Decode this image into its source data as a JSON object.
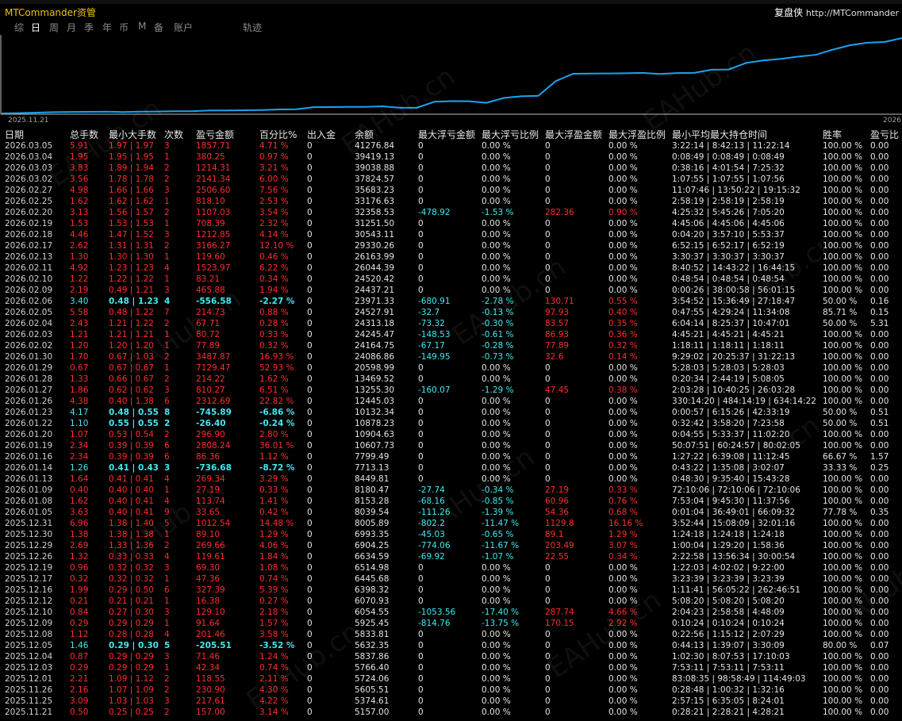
{
  "app": {
    "title": "MTCommander资管",
    "brand": "复盘侠",
    "url": "http://MTCommander"
  },
  "tabs": [
    "综",
    "日",
    "周",
    "月",
    "季",
    "年",
    "币",
    "M",
    "备",
    "账户",
    "轨迹"
  ],
  "active_tab": 1,
  "chart": {
    "start_label": "2025.11.21",
    "end_label": "2026.0",
    "line_color": "#1aa3f0"
  },
  "columns": [
    "日期",
    "总手数",
    "最小大手数",
    "次数",
    "盈亏金额",
    "百分比%",
    "出入金",
    "余额",
    "最大浮亏金额",
    "最大浮亏比例",
    "最大浮盈金额",
    "最大浮盈比例",
    "最小平均最大持仓时间",
    "胜率",
    "盈亏比"
  ],
  "watermark": "EAHub.cn",
  "rows": [
    [
      "2026.03.05",
      "5.91",
      "1.97 | 1.97",
      "3",
      "1857.71",
      "4.71 %",
      "0",
      "41276.84",
      "0",
      "0.00 %",
      "0",
      "0.00 %",
      "3:22:14 | 8:42:13 | 11:22:14",
      "100.00 %",
      "0.00"
    ],
    [
      "2026.03.04",
      "1.95",
      "1.95 | 1.95",
      "1",
      "380.25",
      "0.97 %",
      "0",
      "39419.13",
      "0",
      "0.00 %",
      "0",
      "0.00 %",
      "0:08:49 | 0:08:49 | 0:08:49",
      "100.00 %",
      "0.00"
    ],
    [
      "2026.03.03",
      "3.83",
      "1.89 | 1.94",
      "2",
      "1214.31",
      "3.21 %",
      "0",
      "39038.88",
      "0",
      "0.00 %",
      "0",
      "0.00 %",
      "0:38:16 | 4:01:54 | 7:25:32",
      "100.00 %",
      "0.00"
    ],
    [
      "2026.03.02",
      "3.56",
      "1.78 | 1.78",
      "2",
      "2141.34",
      "6.00 %",
      "0",
      "37824.57",
      "0",
      "0.00 %",
      "0",
      "0.00 %",
      "1:07:55 | 1:07:55 | 1:07:56",
      "100.00 %",
      "0.00"
    ],
    [
      "2026.02.27",
      "4.98",
      "1.66 | 1.66",
      "3",
      "2506.60",
      "7.56 %",
      "0",
      "35683.23",
      "0",
      "0.00 %",
      "0",
      "0.00 %",
      "11:07:46 | 13:50:22 | 19:15:32",
      "100.00 %",
      "0.00"
    ],
    [
      "2026.02.25",
      "1.62",
      "1.62 | 1.62",
      "1",
      "818.10",
      "2.53 %",
      "0",
      "33176.63",
      "0",
      "0.00 %",
      "0",
      "0.00 %",
      "2:58:19 | 2:58:19 | 2:58:19",
      "100.00 %",
      "0.00"
    ],
    [
      "2026.02.20",
      "3.13",
      "1.56 | 1.57",
      "2",
      "1107.03",
      "3.54 %",
      "0",
      "32358.53",
      "-478.92",
      "-1.53 %",
      "282.36",
      "0.90 %",
      "4:25:32 | 5:45:26 | 7:05:20",
      "100.00 %",
      "0.00"
    ],
    [
      "2026.02.19",
      "1.53",
      "1.53 | 1.53",
      "1",
      "708.39",
      "2.32 %",
      "0",
      "31251.50",
      "0",
      "0.00 %",
      "0",
      "0.00 %",
      "4:45:06 | 4:45:06 | 4:45:06",
      "100.00 %",
      "0.00"
    ],
    [
      "2026.02.18",
      "4.46",
      "1.47 | 1.52",
      "3",
      "1212.85",
      "4.14 %",
      "0",
      "30543.11",
      "0",
      "0.00 %",
      "0",
      "0.00 %",
      "0:04:20 | 3:57:10 | 5:53:37",
      "100.00 %",
      "0.00"
    ],
    [
      "2026.02.17",
      "2.62",
      "1.31 | 1.31",
      "2",
      "3166.27",
      "12.10 %",
      "0",
      "29330.26",
      "0",
      "0.00 %",
      "0",
      "0.00 %",
      "6:52:15 | 6:52:17 | 6:52:19",
      "100.00 %",
      "0.00"
    ],
    [
      "2026.02.13",
      "1.30",
      "1.30 | 1.30",
      "1",
      "119.60",
      "0.46 %",
      "0",
      "26163.99",
      "0",
      "0.00 %",
      "0",
      "0.00 %",
      "3:30:37 | 3:30:37 | 3:30:37",
      "100.00 %",
      "0.00"
    ],
    [
      "2026.02.11",
      "4.92",
      "1.23 | 1.23",
      "4",
      "1523.97",
      "6.22 %",
      "0",
      "26044.39",
      "0",
      "0.00 %",
      "0",
      "0.00 %",
      "8:40:52 | 14:43:22 | 16:44:15",
      "100.00 %",
      "0.00"
    ],
    [
      "2026.02.10",
      "1.22",
      "1.22 | 1.22",
      "1",
      "83.21",
      "0.34 %",
      "0",
      "24520.42",
      "0",
      "0.00 %",
      "0",
      "0.00 %",
      "0:48:54 | 0:48:54 | 0:48:54",
      "100.00 %",
      "0.00"
    ],
    [
      "2026.02.09",
      "2.19",
      "0.49 | 1.21",
      "3",
      "465.88",
      "1.94 %",
      "0",
      "24437.21",
      "0",
      "0.00 %",
      "0",
      "0.00 %",
      "0:00:26 | 38:00:58 | 56:01:15",
      "100.00 %",
      "0.00"
    ],
    [
      "2026.02.06",
      "3.40",
      "0.48 | 1.23",
      "4",
      "-556.58",
      "-2.27 %",
      "0",
      "23971.33",
      "-680.91",
      "-2.78 %",
      "130.71",
      "0.55 %",
      "3:54:52 | 15:36:49 | 27:18:47",
      "50.00 %",
      "0.16"
    ],
    [
      "2026.02.05",
      "5.58",
      "0.48 | 1.22",
      "7",
      "214.73",
      "0.88 %",
      "0",
      "24527.91",
      "-32.7",
      "-0.13 %",
      "97.93",
      "0.40 %",
      "0:47:55 | 4:29:24 | 11:34:08",
      "85.71 %",
      "0.15"
    ],
    [
      "2026.02.04",
      "2.43",
      "1.21 | 1.22",
      "2",
      "67.71",
      "0.28 %",
      "0",
      "24313.18",
      "-73.32",
      "-0.30 %",
      "83.57",
      "0.35 %",
      "6:04:14 | 8:25:37 | 10:47:01",
      "50.00 %",
      "5.31"
    ],
    [
      "2026.02.03",
      "1.21",
      "1.21 | 1.21",
      "1",
      "80.72",
      "0.33 %",
      "0",
      "24245.47",
      "-148.53",
      "-0.61 %",
      "86.93",
      "0.36 %",
      "4:45:21 | 4:45:21 | 4:45:21",
      "100.00 %",
      "0.00"
    ],
    [
      "2026.02.02",
      "1.20",
      "1.20 | 1.20",
      "1",
      "77.89",
      "0.32 %",
      "0",
      "24164.75",
      "-67.17",
      "-0.28 %",
      "77.89",
      "0.32 %",
      "1:18:11 | 1:18:11 | 1:18:11",
      "100.00 %",
      "0.00"
    ],
    [
      "2026.01.30",
      "1.70",
      "0.67 | 1.03",
      "2",
      "3487.87",
      "16.93 %",
      "0",
      "24086.86",
      "-149.95",
      "-0.73 %",
      "32.6",
      "0.14 %",
      "9:29:02 | 20:25:37 | 31:22:13",
      "100.00 %",
      "0.00"
    ],
    [
      "2026.01.29",
      "0.67",
      "0.67 | 0.67",
      "1",
      "7129.47",
      "52.93 %",
      "0",
      "20598.99",
      "0",
      "0.00 %",
      "0",
      "0.00 %",
      "5:28:03 | 5:28:03 | 5:28:03",
      "100.00 %",
      "0.00"
    ],
    [
      "2026.01.28",
      "1.33",
      "0.66 | 0.67",
      "2",
      "214.22",
      "1.62 %",
      "0",
      "13469.52",
      "0",
      "0.00 %",
      "0",
      "0.00 %",
      "0:20:34 | 2:44:19 | 5:08:05",
      "100.00 %",
      "0.00"
    ],
    [
      "2026.01.27",
      "1.86",
      "0.62 | 0.62",
      "3",
      "810.27",
      "6.51 %",
      "0",
      "13255.30",
      "-160.07",
      "-1.29 %",
      "47.45",
      "0.38 %",
      "2:03:28 | 10:40:25 | 26:03:28",
      "100.00 %",
      "0.00"
    ],
    [
      "2026.01.26",
      "4.38",
      "0.40 | 1.38",
      "6",
      "2312.69",
      "22.82 %",
      "0",
      "12445.03",
      "0",
      "0.00 %",
      "0",
      "0.00 %",
      "330:14:20 | 484:14:19 | 634:14:22",
      "100.00 %",
      "0.00"
    ],
    [
      "2026.01.23",
      "4.17",
      "0.48 | 0.55",
      "8",
      "-745.89",
      "-6.86 %",
      "0",
      "10132.34",
      "0",
      "0.00 %",
      "0",
      "0.00 %",
      "0:00:57 | 6:15:26 | 42:33:19",
      "50.00 %",
      "0.51"
    ],
    [
      "2026.01.22",
      "1.10",
      "0.55 | 0.55",
      "2",
      "-26.40",
      "-0.24 %",
      "0",
      "10878.23",
      "0",
      "0.00 %",
      "0",
      "0.00 %",
      "0:32:42 | 3:58:20 | 7:23:58",
      "50.00 %",
      "0.51"
    ],
    [
      "2026.01.20",
      "1.07",
      "0.53 | 0.54",
      "2",
      "296.90",
      "2.80 %",
      "0",
      "10904.63",
      "0",
      "0.00 %",
      "0",
      "0.00 %",
      "0:04:55 | 5:33:37 | 11:02:20",
      "100.00 %",
      "0.00"
    ],
    [
      "2026.01.19",
      "2.34",
      "0.39 | 0.39",
      "6",
      "2808.24",
      "36.01 %",
      "0",
      "10607.73",
      "0",
      "0.00 %",
      "0",
      "0.00 %",
      "50:07:51 | 60:24:57 | 80:02:05",
      "100.00 %",
      "0.00"
    ],
    [
      "2026.01.16",
      "2.34",
      "0.39 | 0.39",
      "6",
      "86.36",
      "1.12 %",
      "0",
      "7799.49",
      "0",
      "0.00 %",
      "0",
      "0.00 %",
      "1:27:22 | 6:39:08 | 11:12:45",
      "66.67 %",
      "1.57"
    ],
    [
      "2026.01.14",
      "1.26",
      "0.41 | 0.43",
      "3",
      "-736.68",
      "-8.72 %",
      "0",
      "7713.13",
      "0",
      "0.00 %",
      "0",
      "0.00 %",
      "0:43:22 | 1:35:08 | 3:02:07",
      "33.33 %",
      "0.25"
    ],
    [
      "2026.01.13",
      "1.64",
      "0.41 | 0.41",
      "4",
      "269.34",
      "3.29 %",
      "0",
      "8449.81",
      "0",
      "0.00 %",
      "0",
      "0.00 %",
      "0:48:30 | 9:35:40 | 15:43:28",
      "100.00 %",
      "0.00"
    ],
    [
      "2026.01.09",
      "0.40",
      "0.40 | 0.40",
      "1",
      "27.19",
      "0.33 %",
      "0",
      "8180.47",
      "-27.74",
      "-0.34 %",
      "27.19",
      "0.33 %",
      "72:10:06 | 72:10:06 | 72:10:06",
      "100.00 %",
      "0.00"
    ],
    [
      "2026.01.08",
      "1.62",
      "0.40 | 0.41",
      "4",
      "113.74",
      "1.41 %",
      "0",
      "8153.28",
      "-68.16",
      "-0.85 %",
      "60.96",
      "0.76 %",
      "7:53:04 | 9:45:30 | 11:37:56",
      "100.00 %",
      "0.00"
    ],
    [
      "2026.01.05",
      "3.63",
      "0.40 | 0.41",
      "9",
      "33.65",
      "0.42 %",
      "0",
      "8039.54",
      "-111.26",
      "-1.39 %",
      "54.36",
      "0.68 %",
      "0:01:04 | 36:49:01 | 66:09:32",
      "77.78 %",
      "0.35"
    ],
    [
      "2025.12.31",
      "6.96",
      "1.38 | 1.40",
      "5",
      "1012.54",
      "14.48 %",
      "0",
      "8005.89",
      "-802.2",
      "-11.47 %",
      "1129.8",
      "16.16 %",
      "3:52:44 | 15:08:09 | 32:01:16",
      "100.00 %",
      "0.00"
    ],
    [
      "2025.12.30",
      "1.38",
      "1.38 | 1.38",
      "1",
      "89.10",
      "1.29 %",
      "0",
      "6993.35",
      "-45.03",
      "-0.65 %",
      "89.1",
      "1.29 %",
      "1:24:18 | 1:24:18 | 1:24:18",
      "100.00 %",
      "0.00"
    ],
    [
      "2025.12.29",
      "2.69",
      "1.33 | 1.36",
      "2",
      "269.66",
      "4.06 %",
      "0",
      "6904.25",
      "-774.06",
      "-11.67 %",
      "203.49",
      "3.07 %",
      "1:00:04 | 1:29:20 | 1:58:36",
      "100.00 %",
      "0.00"
    ],
    [
      "2025.12.26",
      "1.32",
      "0.33 | 0.33",
      "4",
      "119.61",
      "1.84 %",
      "0",
      "6634.59",
      "-69.92",
      "-1.07 %",
      "22.55",
      "0.34 %",
      "2:22:58 | 13:56:34 | 30:00:54",
      "100.00 %",
      "0.00"
    ],
    [
      "2025.12.19",
      "0.96",
      "0.32 | 0.32",
      "3",
      "69.30",
      "1.08 %",
      "0",
      "6514.98",
      "0",
      "0.00 %",
      "0",
      "0.00 %",
      "1:22:03 | 4:02:02 | 9:22:00",
      "100.00 %",
      "0.00"
    ],
    [
      "2025.12.17",
      "0.32",
      "0.32 | 0.32",
      "1",
      "47.36",
      "0.74 %",
      "0",
      "6445.68",
      "0",
      "0.00 %",
      "0",
      "0.00 %",
      "3:23:39 | 3:23:39 | 3:23:39",
      "100.00 %",
      "0.00"
    ],
    [
      "2025.12.16",
      "1.99",
      "0.29 | 0.50",
      "6",
      "327.39",
      "5.39 %",
      "0",
      "6398.32",
      "0",
      "0.00 %",
      "0",
      "0.00 %",
      "1:11:41 | 56:05:22 | 262:46:51",
      "100.00 %",
      "0.00"
    ],
    [
      "2025.12.12",
      "0.21",
      "0.21 | 0.21",
      "1",
      "16.38",
      "0.27 %",
      "0",
      "6070.93",
      "0",
      "0.00 %",
      "0",
      "0.00 %",
      "5:08:20 | 5:08:20 | 5:08:20",
      "100.00 %",
      "0.00"
    ],
    [
      "2025.12.10",
      "0.84",
      "0.27 | 0.30",
      "3",
      "129.10",
      "2.18 %",
      "0",
      "6054.55",
      "-1053.56",
      "-17.40 %",
      "287.74",
      "4.66 %",
      "2:04:23 | 2:58:58 | 4:48:09",
      "100.00 %",
      "0.00"
    ],
    [
      "2025.12.09",
      "0.29",
      "0.29 | 0.29",
      "1",
      "91.64",
      "1.57 %",
      "0",
      "5925.45",
      "-814.76",
      "-13.75 %",
      "170.15",
      "2.92 %",
      "0:10:24 | 0:10:24 | 0:10:24",
      "100.00 %",
      "0.00"
    ],
    [
      "2025.12.08",
      "1.12",
      "0.28 | 0.28",
      "4",
      "201.46",
      "3.58 %",
      "0",
      "5833.81",
      "0",
      "0.00 %",
      "0",
      "0.00 %",
      "0:22:56 | 1:15:12 | 2:07:29",
      "100.00 %",
      "0.00"
    ],
    [
      "2025.12.05",
      "1.46",
      "0.29 | 0.30",
      "5",
      "-205.51",
      "-3.52 %",
      "0",
      "5632.35",
      "0",
      "0.00 %",
      "0",
      "0.00 %",
      "0:44:13 | 1:39:07 | 3:30:09",
      "80.00 %",
      "0.07"
    ],
    [
      "2025.12.04",
      "0.87",
      "0.29 | 0.29",
      "3",
      "71.46",
      "1.24 %",
      "0",
      "5837.86",
      "0",
      "0.00 %",
      "0",
      "0.00 %",
      "1:02:30 | 8:07:53 | 17:10:03",
      "100.00 %",
      "0.00"
    ],
    [
      "2025.12.03",
      "0.29",
      "0.29 | 0.29",
      "1",
      "42.34",
      "0.74 %",
      "0",
      "5766.40",
      "0",
      "0.00 %",
      "0",
      "0.00 %",
      "7:53:11 | 7:53:11 | 7:53:11",
      "100.00 %",
      "0.00"
    ],
    [
      "2025.12.01",
      "2.21",
      "1.09 | 1.12",
      "2",
      "118.55",
      "2.11 %",
      "0",
      "5724.06",
      "0",
      "0.00 %",
      "0",
      "0.00 %",
      "83:08:35 | 98:58:49 | 114:49:03",
      "100.00 %",
      "0.00"
    ],
    [
      "2025.11.26",
      "2.16",
      "1.07 | 1.09",
      "2",
      "230.90",
      "4.30 %",
      "0",
      "5605.51",
      "0",
      "0.00 %",
      "0",
      "0.00 %",
      "0:28:48 | 1:00:32 | 1:32:16",
      "100.00 %",
      "0.00"
    ],
    [
      "2025.11.25",
      "3.09",
      "1.03 | 1.03",
      "3",
      "217.61",
      "4.22 %",
      "0",
      "5374.61",
      "0",
      "0.00 %",
      "0",
      "0.00 %",
      "2:57:15 | 6:35:05 | 8:24:01",
      "100.00 %",
      "0.00"
    ],
    [
      "2025.11.21",
      "0.50",
      "0.25 | 0.25",
      "2",
      "157.00",
      "3.14 %",
      "0",
      "5157.00",
      "0",
      "0.00 %",
      "0",
      "0.00 %",
      "0:28:21 | 2:28:21 | 4:28:21",
      "100.00 %",
      "0.00"
    ]
  ]
}
